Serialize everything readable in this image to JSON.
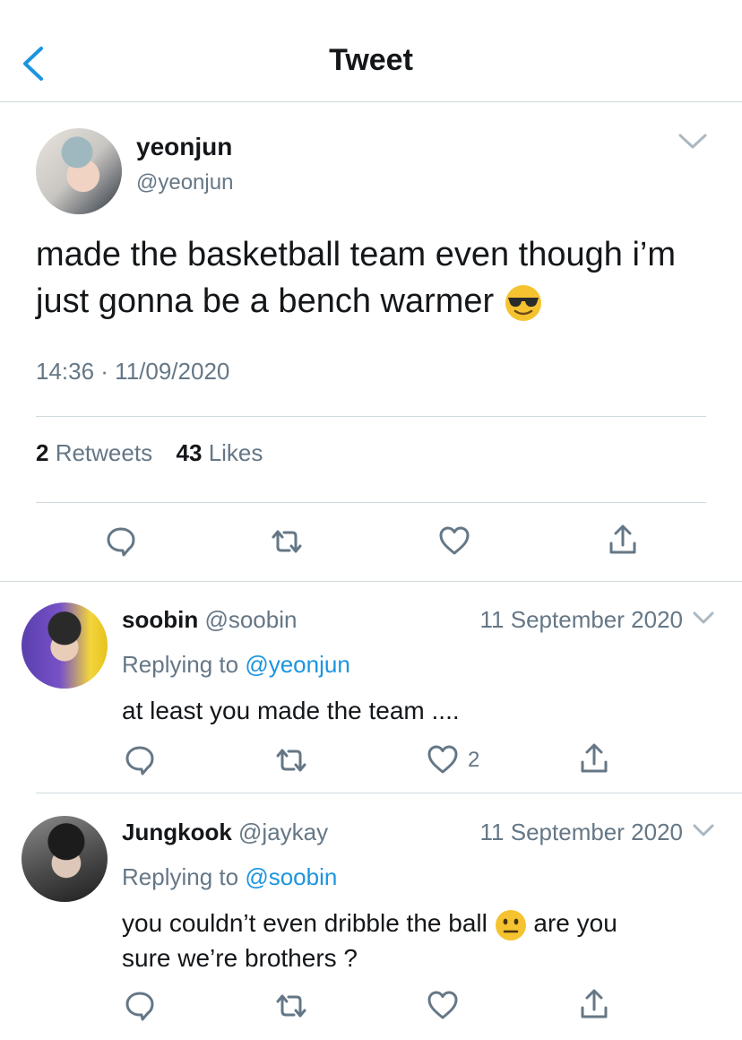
{
  "header": {
    "title": "Tweet",
    "back_icon": "chevron-left-icon"
  },
  "tweet": {
    "name": "yeonjun",
    "handle": "@yeonjun",
    "text": "made the basketball team even though i’m just gonna be a bench warmer",
    "emoji": "smiling-face-with-sunglasses",
    "time": "14:36 · 11/09/2020",
    "retweets_count": "2",
    "retweets_label": " Retweets",
    "likes_count": "43",
    "likes_label": " Likes"
  },
  "replies": [
    {
      "name": "soobin",
      "handle": "@soobin",
      "date": "11 September 2020",
      "replying_prefix": "Replying to ",
      "replying_to": "@yeonjun",
      "text": "at least you made the team ....",
      "likes": "2"
    },
    {
      "name": "Jungkook",
      "handle": "@jaykay",
      "date": "11 September 2020",
      "replying_prefix": "Replying to ",
      "replying_to": "@soobin",
      "text_before": "you couldn’t even dribble the ball",
      "text_emoji": "neutral-face",
      "text_after": "are you",
      "text_line2": "sure we’re brothers ?"
    }
  ],
  "colors": {
    "accent": "#1b95e0",
    "secondary": "#657786",
    "divider": "#cfd9de",
    "emoji": "#f5c32f"
  }
}
